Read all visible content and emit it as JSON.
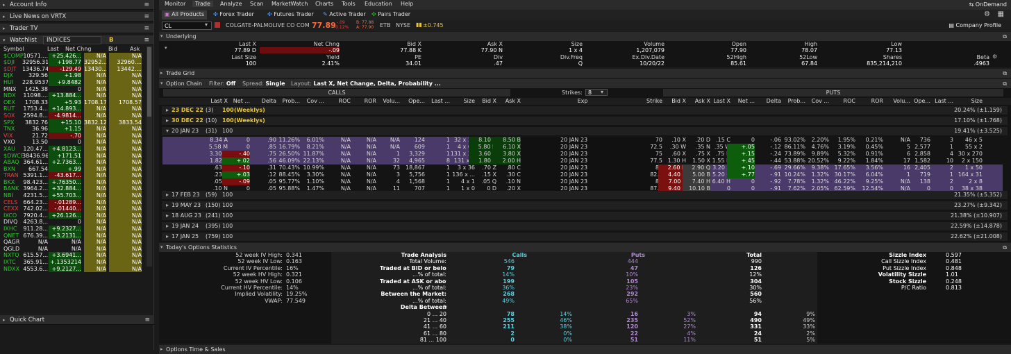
{
  "left": {
    "account_info": "Account Info",
    "live_news": "Live News on VRTX",
    "trader_tv": "Trader TV",
    "watchlist": "Watchlist",
    "watchlist_name": "INDICES",
    "cols": [
      "Symbol",
      "Last",
      "Net Chng",
      "Bid",
      "Ask"
    ],
    "rows": [
      [
        "$COMP",
        "10571....",
        "+25.426...",
        "N/A",
        "N/A",
        "g"
      ],
      [
        "$DJI",
        "32956.31",
        "+198.77",
        "32952....",
        "32960....",
        "g"
      ],
      [
        "$DJT",
        "13436.74",
        "-129.49",
        "13430....",
        "13442....",
        "r"
      ],
      [
        "DJX",
        "329.56",
        "+1.98",
        "N/A",
        "N/A",
        "g"
      ],
      [
        "HUI",
        "228.9537",
        "+9.8482",
        "N/A",
        "N/A",
        "g"
      ],
      [
        "MNX",
        "1425.38",
        "0",
        "N/A",
        "N/A",
        "w"
      ],
      [
        "NDX",
        "11098....",
        "+13.884...",
        "N/A",
        "N/A",
        "g"
      ],
      [
        "OEX",
        "1708.33",
        "+5.93",
        "1708.17",
        "1708.57",
        "g"
      ],
      [
        "RUT",
        "1753.4...",
        "+14.893...",
        "N/A",
        "N/A",
        "g"
      ],
      [
        "SOX",
        "2594.8...",
        "-4.9814...",
        "N/A",
        "N/A",
        "r"
      ],
      [
        "SPX",
        "3832.76",
        "+15.10",
        "3832.12",
        "3833.54",
        "g"
      ],
      [
        "TNX",
        "36.96",
        "+1.15",
        "N/A",
        "N/A",
        "g"
      ],
      [
        "VIX",
        "21.72",
        "-.70",
        "N/A",
        "N/A",
        "r"
      ],
      [
        "VXO",
        "13.50",
        "0",
        "N/A",
        "N/A",
        "w"
      ],
      [
        "XAU",
        "120.47...",
        "+4.8123...",
        "N/A",
        "N/A",
        "g"
      ],
      [
        "$DWCF",
        "38436.96",
        "+171.51",
        "N/A",
        "N/A",
        "g"
      ],
      [
        "ABAQ",
        "364.61...",
        "+2.7363...",
        "N/A",
        "N/A",
        "g"
      ],
      [
        "BXN",
        "667.54",
        "+.99",
        "N/A",
        "N/A",
        "g"
      ],
      [
        "TRAN",
        "5391.1...",
        "-43.617...",
        "N/A",
        "N/A",
        "r"
      ],
      [
        "BKX",
        "98.423...",
        "+.76350...",
        "N/A",
        "N/A",
        "g"
      ],
      [
        "BANK",
        "3964.2...",
        "+32.884...",
        "N/A",
        "N/A",
        "g"
      ],
      [
        "NBI",
        "4231.5...",
        "+55.703...",
        "N/A",
        "N/A",
        "g"
      ],
      [
        "CELS",
        "664.23...",
        "-.01289...",
        "N/A",
        "N/A",
        "r"
      ],
      [
        "CEXX",
        "742.02...",
        "-.01440...",
        "N/A",
        "N/A",
        "r"
      ],
      [
        "IXCO",
        "7920.4...",
        "+26.126...",
        "N/A",
        "N/A",
        "g"
      ],
      [
        "DIVQ",
        "4263.8...",
        "0",
        "N/A",
        "N/A",
        "w"
      ],
      [
        "IXHC",
        "911.28...",
        "+9.2327...",
        "N/A",
        "N/A",
        "g"
      ],
      [
        "QNET",
        "676.39...",
        "+3.2131...",
        "N/A",
        "N/A",
        "g"
      ],
      [
        "QAGR",
        "N/A",
        "N/A",
        "N/A",
        "N/A",
        "w"
      ],
      [
        "QGLD",
        "N/A",
        "N/A",
        "N/A",
        "N/A",
        "w"
      ],
      [
        "NXTQ",
        "615.57...",
        "+3.6941...",
        "N/A",
        "N/A",
        "g"
      ],
      [
        "IXTC",
        "365.91...",
        "+.1353214",
        "N/A",
        "N/A",
        "g"
      ],
      [
        "NDXX",
        "4553.6...",
        "+9.2127...",
        "N/A",
        "N/A",
        "g"
      ]
    ],
    "quick_chart": "Quick Chart"
  },
  "menu": [
    "Monitor",
    "Trade",
    "Analyze",
    "Scan",
    "MarketWatch",
    "Charts",
    "Tools",
    "Education",
    "Help"
  ],
  "ondemand": "OnDemand",
  "subtabs": [
    "All Products",
    "Forex Trader",
    "Futures Trader",
    "Active Trader",
    "Pairs Trader"
  ],
  "symbol": {
    "ticker": "CL",
    "name": "COLGATE-PALMOLIVE CO COM",
    "price": "77.89",
    "chg1": "-.09",
    "chg2": "-0.12%",
    "bid": "B: 77.88",
    "ask": "A: 77.90",
    "exch1": "ETB",
    "exch2": "NYSE",
    "div": "±0.745",
    "company_profile": "Company Profile"
  },
  "underlying": {
    "title": "Underlying",
    "row1_labels": [
      "Last X",
      "Net Chng",
      "Bid X",
      "Ask X",
      "Size",
      "Volume",
      "Open",
      "High",
      "Low"
    ],
    "row1_values": [
      "77.89 D",
      "-.09",
      "77.88 K",
      "77.90 N",
      "1 x 4",
      "1,207,079",
      "77.90",
      "78.07",
      "77.13"
    ],
    "row2_labels": [
      "Last Size",
      "Yield",
      "PE",
      "Div",
      "Div.Freq",
      "Ex.Div.Date",
      "52High",
      "52Low",
      "Shares",
      "Beta"
    ],
    "row2_values": [
      "100",
      "2.41%",
      "34.01",
      ".47",
      "Q",
      "10/20/22",
      "85.61",
      "67.84",
      "835,214,210",
      ".4963"
    ]
  },
  "trade_grid": "Trade Grid",
  "option_chain": {
    "title": "Option Chain",
    "filter_label": "Filter:",
    "filter": "Off",
    "spread_label": "Spread:",
    "spread": "Single",
    "layout_label": "Layout:",
    "layout": "Last X, Net Change, Delta, Probability ...",
    "calls": "CALLS",
    "puts": "PUTS",
    "strikes_label": "Strikes:",
    "strikes": "8",
    "call_cols": [
      "Last X",
      "Net ...",
      "Delta",
      "Prob...",
      "Cov ...",
      "ROC",
      "ROR",
      "Volu...",
      "Ope...",
      "Last ...",
      "Size",
      "Bid X",
      "Ask X"
    ],
    "mid_cols": [
      "Exp",
      "Strike"
    ],
    "put_cols": [
      "Bid X",
      "Ask X",
      "Last X",
      "Net ...",
      "Delta",
      "Prob...",
      "Cov ...",
      "ROC",
      "ROR",
      "Volu...",
      "Ope...",
      "Last ...",
      "Size"
    ],
    "series_top": [
      {
        "exp": "23 DEC 22",
        "days": "(3)",
        "mult": "100",
        "tag": "(Weeklys)",
        "iv": "20.24% (±1.159)"
      },
      {
        "exp": "30 DEC 22",
        "days": "(10)",
        "mult": "100",
        "tag": "(Weeklys)",
        "iv": "17.10% (±1.768)"
      },
      {
        "exp": "20 JAN 23",
        "days": "(31)",
        "mult": "100",
        "tag": "",
        "iv": "19.41% (±3.525)"
      }
    ],
    "rows": [
      [
        "8.34 A",
        "0",
        ".90",
        "11.26%",
        "6.01%",
        "N/A",
        "N/A",
        "N/A",
        "124",
        "1",
        "32 x 32",
        "8.10 B",
        "8.50 B",
        "20 JAN 23",
        "70",
        ".10 X",
        ".20 D",
        ".15 C",
        "0",
        "-.06",
        "93.02%",
        "2.20%",
        "1.95%",
        "0.21%",
        "N/A",
        "736",
        "3",
        "46 x 5"
      ],
      [
        "5.58 M",
        "0",
        ".85",
        "16.79%",
        "8.21%",
        "N/A",
        "N/A",
        "N/A",
        "609",
        "1",
        "4 x 62",
        "5.80 H",
        "6.10 X",
        "20 JAN 23",
        "72.5",
        ".30 W",
        ".35 N",
        ".35 W",
        "+.05",
        "-.12",
        "86.11%",
        "4.76%",
        "3.19%",
        "0.45%",
        "5",
        "2,577",
        "1",
        "55 x 2"
      ],
      [
        "3.30 D",
        "-.40",
        ".75",
        "26.50%",
        "11.87%",
        "N/A",
        "N/A",
        "1",
        "3,329",
        "1",
        "131 x 30",
        "3.60 X",
        "3.80 X",
        "20 JAN 23",
        "75",
        ".60 X",
        ".75 X",
        ".75 N",
        "+.15",
        "-.24",
        "73.89%",
        "9.89%",
        "5.32%",
        "0.91%",
        "6",
        "2,858",
        "4",
        "30 x 270"
      ],
      [
        "1.82 Z",
        "+.02",
        ".56",
        "46.09%",
        "22.13%",
        "N/A",
        "N/A",
        "32",
        "4,965",
        "8",
        "131 x 2",
        "1.80 X",
        "2.00 H",
        "20 JAN 23",
        "77.5",
        "1.30 H",
        "1.50 X",
        "1.55 N",
        "+.45",
        "-.44",
        "53.88%",
        "20.52%",
        "9.22%",
        "1.84%",
        "17",
        "1,582",
        "10",
        "2 x 150"
      ],
      [
        ".63 B",
        "-.10",
        ".31",
        "70.43%",
        "10.99%",
        "N/A",
        "N/A",
        "73",
        "18,867",
        "1",
        "3 x 36",
        ".70 Z",
        ".80 C",
        "20 JAN 23",
        "80",
        "2.60 N",
        "2.90 Q",
        "3.20 A",
        "+.10",
        "-.69",
        "29.66%",
        "9.38%",
        "17.65%",
        "3.56%",
        "16",
        "2,405",
        "2",
        "1 x 50"
      ],
      [
        ".23 X",
        "+.03",
        ".12",
        "88.45%",
        "3.30%",
        "N/A",
        "N/A",
        "3",
        "5,756",
        "1",
        "136 x ...",
        ".15 X",
        ".30 C",
        "20 JAN 23",
        "82.5",
        "4.40 X",
        "5.00 B",
        "5.20 C",
        "+.77",
        "-.91",
        "10.24%",
        "1.32%",
        "30.17%",
        "6.04%",
        "1",
        "719",
        "1",
        "164 x 31"
      ],
      [
        ".05 C",
        "-.09",
        ".05",
        "95.77%",
        "1.10%",
        "N/A",
        "N/A",
        "4",
        "1,568",
        "1",
        "4 x 1",
        ".05 Q",
        ".10 N",
        "20 JAN 23",
        "85",
        "7.00 E",
        "7.40 H",
        "6.40 H",
        "0",
        "-.92",
        "7.78%",
        "1.32%",
        "46.22%",
        "9.25%",
        "N/A",
        "138",
        "2",
        "2 x 8"
      ],
      [
        ".10 N",
        "0",
        ".05",
        "95.88%",
        "1.47%",
        "N/A",
        "N/A",
        "11",
        "707",
        "1",
        "1 x 0",
        "0 D",
        ".20 X",
        "20 JAN 23",
        "87.5",
        "9.40 B",
        "10.10 B",
        "0",
        "0",
        "-.91",
        "7.62%",
        "2.05%",
        "62.59%",
        "12.54%",
        "N/A",
        "0",
        "0",
        "38 x 38"
      ]
    ],
    "series_bottom": [
      {
        "exp": "17 FEB 23",
        "days": "(59)",
        "mult": "100",
        "iv": "21.35% (±5.352)"
      },
      {
        "exp": "19 MAY 23",
        "days": "(150)",
        "mult": "100",
        "iv": "23.27% (±9.342)"
      },
      {
        "exp": "18 AUG 23",
        "days": "(241)",
        "mult": "100",
        "iv": "21.38% (±10.907)"
      },
      {
        "exp": "19 JAN 24",
        "days": "(395)",
        "mult": "100",
        "iv": "22.59% (±14.878)"
      },
      {
        "exp": "17 JAN 25",
        "days": "(759)",
        "mult": "100",
        "iv": "22.62% (±21.008)"
      }
    ]
  },
  "stats": {
    "title": "Today's Options Statistics",
    "left": [
      [
        "52 week IV High:",
        "0.341"
      ],
      [
        "52 week IV Low:",
        "0.163"
      ],
      [
        "Current IV Percentile:",
        "16%"
      ],
      [
        "52 week HV High:",
        "0.321"
      ],
      [
        "52 week HV Low:",
        "0.106"
      ],
      [
        "Current HV Percentile:",
        "14%"
      ],
      [
        "Implied Volatility:",
        "19.25%"
      ],
      [
        "VWAP:",
        "77.549"
      ]
    ],
    "head": [
      "Trade Analysis",
      "Calls",
      "Puts",
      "Total"
    ],
    "mid": [
      [
        "Total Volume:",
        "546",
        "",
        "444",
        "",
        "990",
        "",
        false
      ],
      [
        "Traded at BID or below:",
        "79",
        "",
        "47",
        "",
        "126",
        "",
        true
      ],
      [
        "...% of total:",
        "14%",
        "",
        "10%",
        "",
        "12%",
        "",
        false
      ],
      [
        "Traded at ASK or above:",
        "199",
        "",
        "105",
        "",
        "304",
        "",
        true
      ],
      [
        "...% of total:",
        "36%",
        "",
        "23%",
        "",
        "30%",
        "",
        false
      ],
      [
        "Between the Market:",
        "268",
        "",
        "292",
        "",
        "560",
        "",
        true
      ],
      [
        "...% of total:",
        "49%",
        "",
        "65%",
        "",
        "56%",
        "",
        false
      ],
      [
        "Delta Between",
        "",
        "",
        "",
        "",
        "",
        "",
        true
      ],
      [
        "0 ... 20",
        "78",
        "14%",
        "16",
        "3%",
        "94",
        "9%",
        false
      ],
      [
        "21 ... 40",
        "255",
        "46%",
        "235",
        "52%",
        "490",
        "49%",
        false
      ],
      [
        "41 ... 60",
        "211",
        "38%",
        "120",
        "27%",
        "331",
        "33%",
        false
      ],
      [
        "61 ... 80",
        "2",
        "0%",
        "22",
        "4%",
        "24",
        "2%",
        false
      ],
      [
        "81 ... 100",
        "0",
        "0%",
        "51",
        "11%",
        "51",
        "5%",
        false
      ]
    ],
    "right": [
      [
        "Sizzle Index",
        "0.597",
        true
      ],
      [
        "Call Sizzle Index",
        "0.481",
        false
      ],
      [
        "Put Sizzle Index",
        "0.848",
        false
      ],
      [
        "Volatility Sizzle",
        "1.01",
        true
      ],
      [
        "Stock Sizzle",
        "0.248",
        true
      ],
      [
        "P/C Ratio",
        "0.813",
        false
      ]
    ]
  },
  "bottom": "Options Time & Sales"
}
